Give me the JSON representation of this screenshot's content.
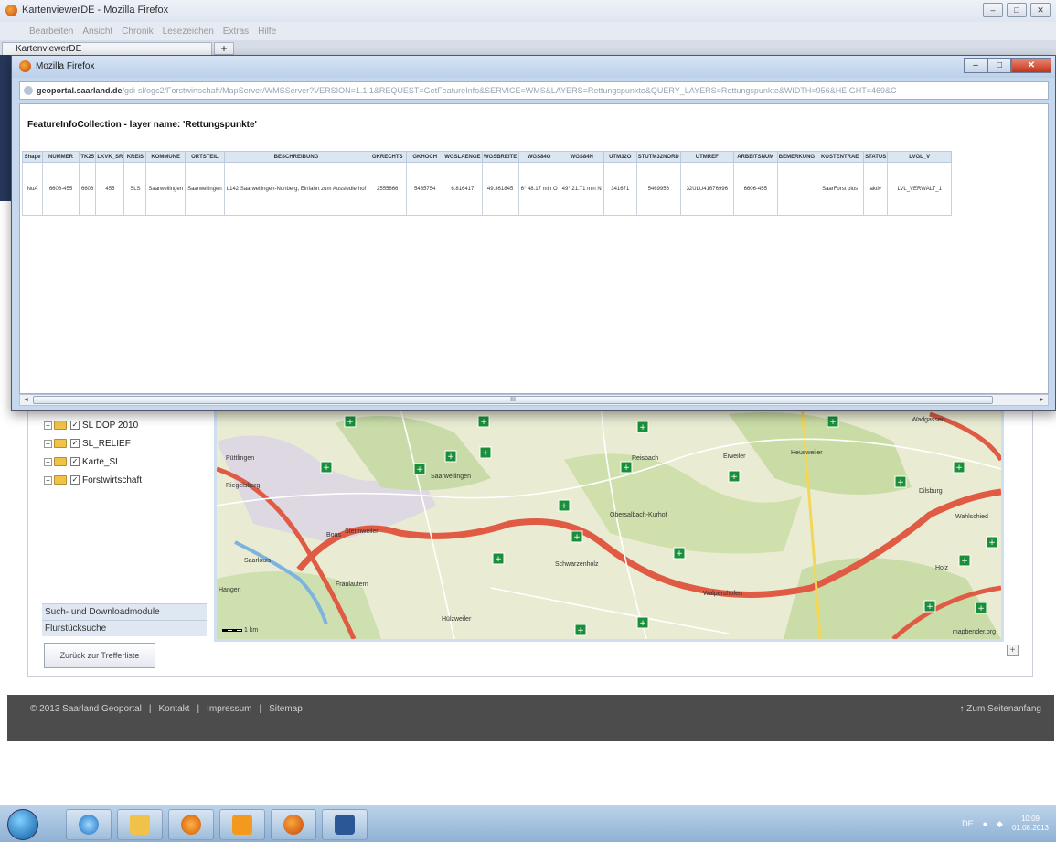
{
  "browser": {
    "title": "KartenviewerDE - Mozilla Firefox",
    "menu": [
      "Bearbeiten",
      "Ansicht",
      "Chronik",
      "Lesezeichen",
      "Extras",
      "Hilfe"
    ],
    "tab_label": "KartenviewerDE",
    "new_tab": "+",
    "window_controls": [
      "–",
      "□",
      "✕"
    ]
  },
  "popup": {
    "title": "Mozilla Firefox",
    "url_domain": "geoportal.saarland.de",
    "url_rest": "/gdi-sl/ogc2/Forstwirtschaft/MapServer/WMSServer?VERSION=1.1.1&REQUEST=GetFeatureInfo&SERVICE=WMS&LAYERS=Rettungspunkte&QUERY_LAYERS=Rettungspunkte&WIDTH=956&HEIGHT=469&C",
    "controls": [
      "–",
      "□",
      "✕"
    ],
    "heading": "FeatureInfoCollection - layer name: 'Rettungspunkte'",
    "table": {
      "headers": [
        "Shape",
        "NUMMER",
        "TK25",
        "LKVK_SR",
        "KREIS",
        "KOMMUNE",
        "ORTSTEIL",
        "BESCHREIBUNG",
        "GKRECHTS",
        "GKHOCH",
        "WGSLAENGE",
        "WGSBREITE",
        "WGS84O",
        "WGS84N",
        "UTM32O",
        "STUTM32NORD",
        "UTMREF",
        "ARBEITSNUM",
        "BEMERKUNG",
        "KOSTENTRAE",
        "STATUS",
        "LVGL_V"
      ],
      "rows": [
        [
          "NuA",
          "6606-455",
          "6606",
          "455",
          "SLS",
          "Saarwellingen",
          "Saarwellingen",
          "L142 Saarwellingen-Nonberg, Einfahrt zum Aussiedlerhof",
          "2555666",
          "5465754",
          "6.816417",
          "49.361845",
          "6° 48.17 min O",
          "49° 21.71 min N",
          "341671",
          "5469956",
          "32ULU41676996",
          "6606-455",
          "",
          "SaarForst plus",
          "aktiv",
          "LVL_VERWALT_1"
        ]
      ]
    },
    "scroll_glyph": "III"
  },
  "layers": [
    {
      "label": "SL DOP 2010",
      "checked": "✓"
    },
    {
      "label": "SL_RELIEF",
      "checked": "✓"
    },
    {
      "label": "Karte_SL",
      "checked": "✓"
    },
    {
      "label": "Forstwirtschaft",
      "checked": "✓"
    }
  ],
  "modules": [
    "Such- und Downloadmodule",
    "Flurstücksuche"
  ],
  "back_button": "Zurück zur Trefferliste",
  "map": {
    "attribution": "mapbender.org",
    "scale_label": "1 km",
    "places": [
      "Wadgassen",
      "Saarwellingen",
      "Eiweiler",
      "Heusweiler",
      "Dilsburg",
      "Wahlschied",
      "Stennweiler",
      "Püttlingen",
      "Riegelsberg",
      "Walpershofen",
      "Holz",
      "Schwarzenholz",
      "Hülzweiler",
      "Fraulautern",
      "Bous",
      "Reisbach",
      "Obersalbach-Kurhof",
      "Hangen",
      "Saarlouis"
    ]
  },
  "footer": {
    "copyright": "© 2013 Saarland Geoportal",
    "links": [
      "Kontakt",
      "Impressum",
      "Sitemap"
    ],
    "separator": "|",
    "to_top": "↑ Zum Seitenanfang"
  },
  "taskbar": {
    "lang": "DE",
    "time": "10:09",
    "date": "01.08.2013"
  },
  "colors": {
    "accent": "#26375a",
    "footer": "#4c4c4c",
    "map_road": "#e05a44",
    "rescue_point": "#1a8f3a"
  }
}
